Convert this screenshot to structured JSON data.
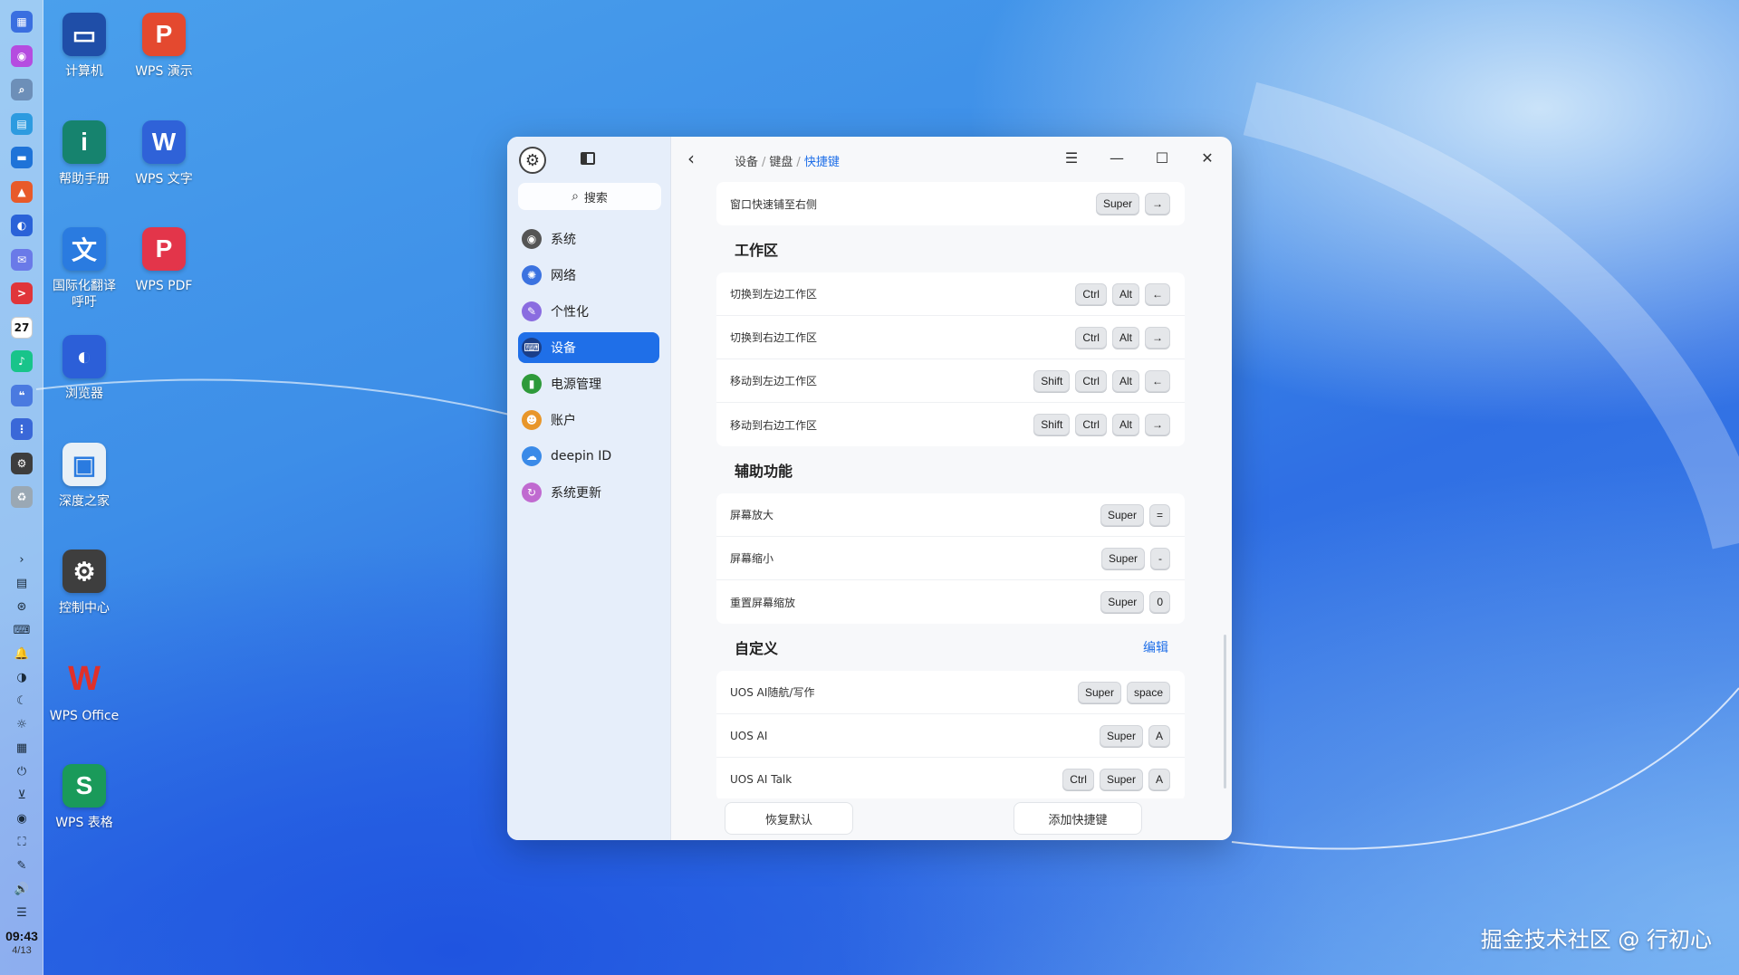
{
  "dock": {
    "time": "09:43",
    "date": "4/13",
    "apps": [
      {
        "icon": "launcher-icon",
        "color": "#3a6fe0",
        "glyph": "▦"
      },
      {
        "icon": "app-store-icon",
        "color": "#b54ce0",
        "glyph": "◉"
      },
      {
        "icon": "search-icon",
        "color": "#6d8fb8",
        "glyph": "⌕"
      },
      {
        "icon": "multitask-icon",
        "color": "#2d9be0",
        "glyph": "▤"
      },
      {
        "icon": "file-manager-icon",
        "color": "#1e73d8",
        "glyph": "▬"
      },
      {
        "icon": "app-store-icon",
        "color": "#e85a2a",
        "glyph": "▲"
      },
      {
        "icon": "browser-icon",
        "color": "#2a62d8",
        "glyph": "◐"
      },
      {
        "icon": "mail-icon",
        "color": "#6a7ae8",
        "glyph": "✉"
      },
      {
        "icon": "terminal-icon",
        "color": "#e0353a",
        "glyph": ">"
      },
      {
        "icon": "calendar-icon",
        "color": "#ffffff",
        "glyph": "27"
      },
      {
        "icon": "music-icon",
        "color": "#18c48a",
        "glyph": "♪"
      },
      {
        "icon": "chat-icon",
        "color": "#4a7ae0",
        "glyph": "❝"
      },
      {
        "icon": "system-monitor-icon",
        "color": "#3a68d8",
        "glyph": "⋮"
      },
      {
        "icon": "control-center-icon",
        "color": "#3d3d3d",
        "glyph": "⚙"
      },
      {
        "icon": "trash-icon",
        "color": "#9aa8b4",
        "glyph": "♻"
      }
    ],
    "tray": [
      {
        "icon": "chevron-right-icon",
        "glyph": "›"
      },
      {
        "icon": "clipboard-icon",
        "glyph": "▤"
      },
      {
        "icon": "network-icon",
        "glyph": "⊛"
      },
      {
        "icon": "keyboard-icon",
        "glyph": "⌨"
      },
      {
        "icon": "notification-icon",
        "glyph": "🔔"
      },
      {
        "icon": "theme-icon",
        "glyph": "◑"
      },
      {
        "icon": "night-mode-icon",
        "glyph": "☾"
      },
      {
        "icon": "brightness-icon",
        "glyph": "☼"
      },
      {
        "icon": "calculator-icon",
        "glyph": "▦"
      },
      {
        "icon": "power-icon",
        "glyph": "⏻"
      },
      {
        "icon": "download-icon",
        "glyph": "⊻"
      },
      {
        "icon": "record-icon",
        "glyph": "◉"
      },
      {
        "icon": "screenshot-icon",
        "glyph": "⛶"
      },
      {
        "icon": "pen-icon",
        "glyph": "✎"
      },
      {
        "icon": "volume-icon",
        "glyph": "🔊"
      },
      {
        "icon": "storage-icon",
        "glyph": "☰"
      }
    ]
  },
  "desktop": {
    "icons": [
      {
        "label": "计算机",
        "icon": "computer-icon",
        "color": "#1f4ea8",
        "glyph": "▭"
      },
      {
        "label": "WPS 演示",
        "icon": "wps-presentation-icon",
        "color": "#e4492f",
        "glyph": "P"
      },
      {
        "label": "帮助手册",
        "icon": "help-manual-icon",
        "color": "#16836e",
        "glyph": "i"
      },
      {
        "label": "WPS 文字",
        "icon": "wps-writer-icon",
        "color": "#2f62d8",
        "glyph": "W"
      },
      {
        "label": "国际化翻译\n呼吁",
        "icon": "translate-icon",
        "color": "#2a7be0",
        "glyph": "文"
      },
      {
        "label": "WPS PDF",
        "icon": "wps-pdf-icon",
        "color": "#e3354a",
        "glyph": "P"
      },
      {
        "label": "浏览器",
        "icon": "browser-icon",
        "color": "#2c5fd8",
        "glyph": "◐"
      },
      {
        "label": "深度之家",
        "icon": "deepin-home-icon",
        "color": "#e8f0f7",
        "glyph": "▣"
      },
      {
        "label": "控制中心",
        "icon": "control-center-icon",
        "color": "#3e3e3e",
        "glyph": "⚙"
      },
      {
        "label": "WPS Office",
        "icon": "wps-office-icon",
        "color": "transparent",
        "glyph": "W"
      },
      {
        "label": "WPS 表格",
        "icon": "wps-spreadsheet-icon",
        "color": "#1a9a5a",
        "glyph": "S"
      }
    ]
  },
  "window": {
    "search_placeholder": "搜索",
    "nav": [
      {
        "label": "系统",
        "icon": "system-icon",
        "color": "#555555",
        "glyph": "◉"
      },
      {
        "label": "网络",
        "icon": "network-icon",
        "color": "#3b72e0",
        "glyph": "✺"
      },
      {
        "label": "个性化",
        "icon": "personalization-icon",
        "color": "#8a6ce0",
        "glyph": "✎"
      },
      {
        "label": "设备",
        "icon": "devices-icon",
        "color": "#1a3f8a",
        "glyph": "⌨",
        "active": true
      },
      {
        "label": "电源管理",
        "icon": "power-management-icon",
        "color": "#2e9a3a",
        "glyph": "▮"
      },
      {
        "label": "账户",
        "icon": "accounts-icon",
        "color": "#e8962a",
        "glyph": "☻"
      },
      {
        "label": "deepin ID",
        "icon": "cloud-icon",
        "color": "#3a8ae8",
        "glyph": "☁"
      },
      {
        "label": "系统更新",
        "icon": "update-icon",
        "color": "#c06ad0",
        "glyph": "↻"
      }
    ],
    "breadcrumb": {
      "a": "设备",
      "b": "键盘",
      "c": "快捷键"
    },
    "accent": "#1f6fe8",
    "top_row": {
      "label": "窗口快速铺至右侧",
      "keys": [
        "Super",
        "→"
      ]
    },
    "sections": [
      {
        "title": "工作区",
        "rows": [
          {
            "label": "切换到左边工作区",
            "keys": [
              "Ctrl",
              "Alt",
              "←"
            ]
          },
          {
            "label": "切换到右边工作区",
            "keys": [
              "Ctrl",
              "Alt",
              "→"
            ]
          },
          {
            "label": "移动到左边工作区",
            "keys": [
              "Shift",
              "Ctrl",
              "Alt",
              "←"
            ]
          },
          {
            "label": "移动到右边工作区",
            "keys": [
              "Shift",
              "Ctrl",
              "Alt",
              "→"
            ]
          }
        ]
      },
      {
        "title": "辅助功能",
        "rows": [
          {
            "label": "屏幕放大",
            "keys": [
              "Super",
              "="
            ]
          },
          {
            "label": "屏幕缩小",
            "keys": [
              "Super",
              "-"
            ]
          },
          {
            "label": "重置屏幕缩放",
            "keys": [
              "Super",
              "0"
            ]
          }
        ]
      },
      {
        "title": "自定义",
        "edit": "编辑",
        "rows": [
          {
            "label": "UOS AI随航/写作",
            "keys": [
              "Super",
              "space"
            ]
          },
          {
            "label": "UOS AI",
            "keys": [
              "Super",
              "A"
            ]
          },
          {
            "label": "UOS AI Talk",
            "keys": [
              "Ctrl",
              "Super",
              "A"
            ]
          }
        ]
      }
    ],
    "buttons": {
      "restore": "恢复默认",
      "add": "添加快捷键"
    }
  },
  "watermark": "掘金技术社区 @ 行初心"
}
